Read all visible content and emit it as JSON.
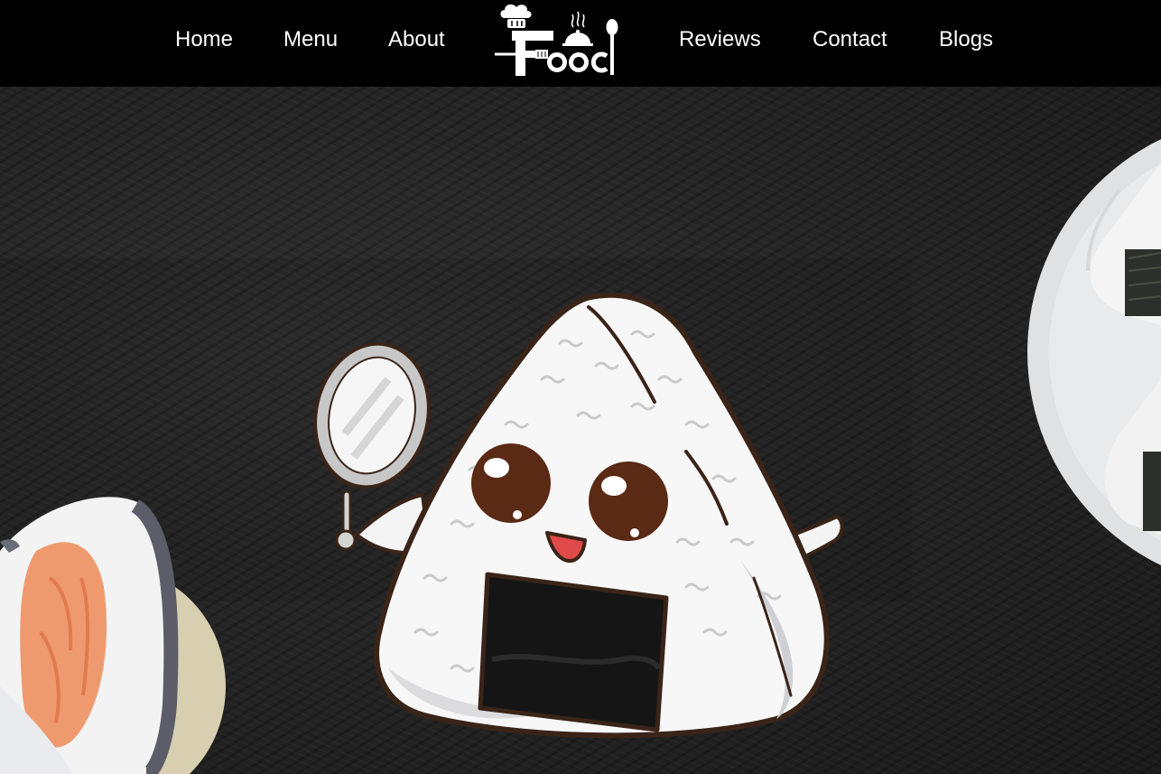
{
  "nav": {
    "items_left": [
      "Home",
      "Menu",
      "About"
    ],
    "items_right": [
      "Reviews",
      "Contact",
      "Blogs"
    ],
    "logo_text": "Food"
  },
  "colors": {
    "nav_bg": "#000000",
    "nav_text": "#ffffff",
    "hero_bg": "#232323",
    "mascot_outline": "#3a2418",
    "seaweed": "#151515"
  },
  "icons": [
    "chef-hat-icon",
    "cloche-icon",
    "spoon-icon",
    "spatula-icon",
    "hand-mirror-icon"
  ]
}
